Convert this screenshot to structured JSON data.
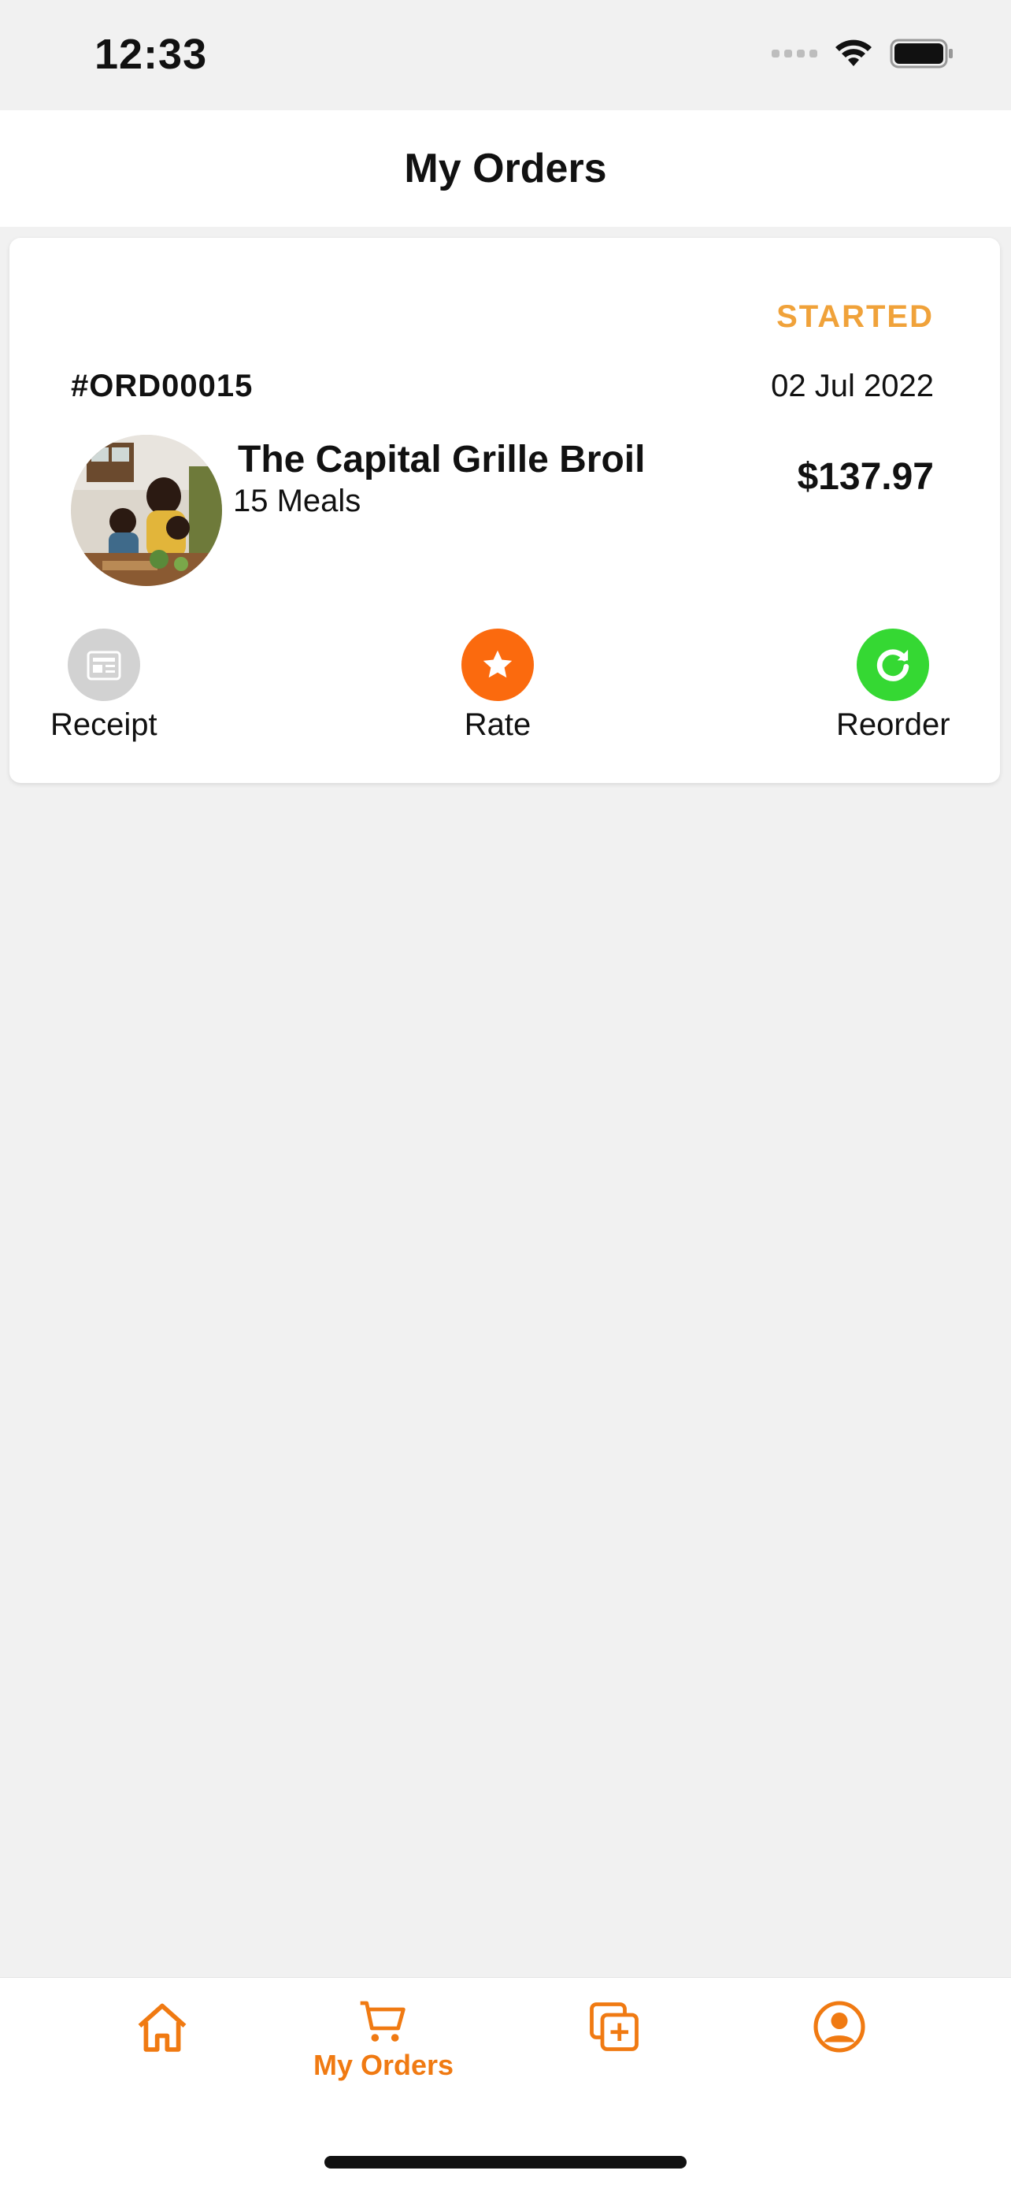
{
  "status_bar": {
    "time": "12:33"
  },
  "header": {
    "title": "My Orders"
  },
  "order": {
    "status": "STARTED",
    "id": "#ORD00015",
    "date": "02 Jul 2022",
    "restaurant": "The Capital Grille Broil",
    "meals": "15 Meals",
    "price": "$137.97",
    "actions": {
      "receipt": "Receipt",
      "rate": "Rate",
      "reorder": "Reorder"
    }
  },
  "tab_bar": {
    "active_label": "My Orders",
    "items": [
      "home-icon",
      "cart-icon",
      "add-copy-icon",
      "profile-icon"
    ]
  },
  "colors": {
    "accent": "#f07a12",
    "status": "#f0a23a",
    "rate": "#fb6a0e",
    "reorder": "#35d833",
    "receipt": "#cfcfcf"
  }
}
